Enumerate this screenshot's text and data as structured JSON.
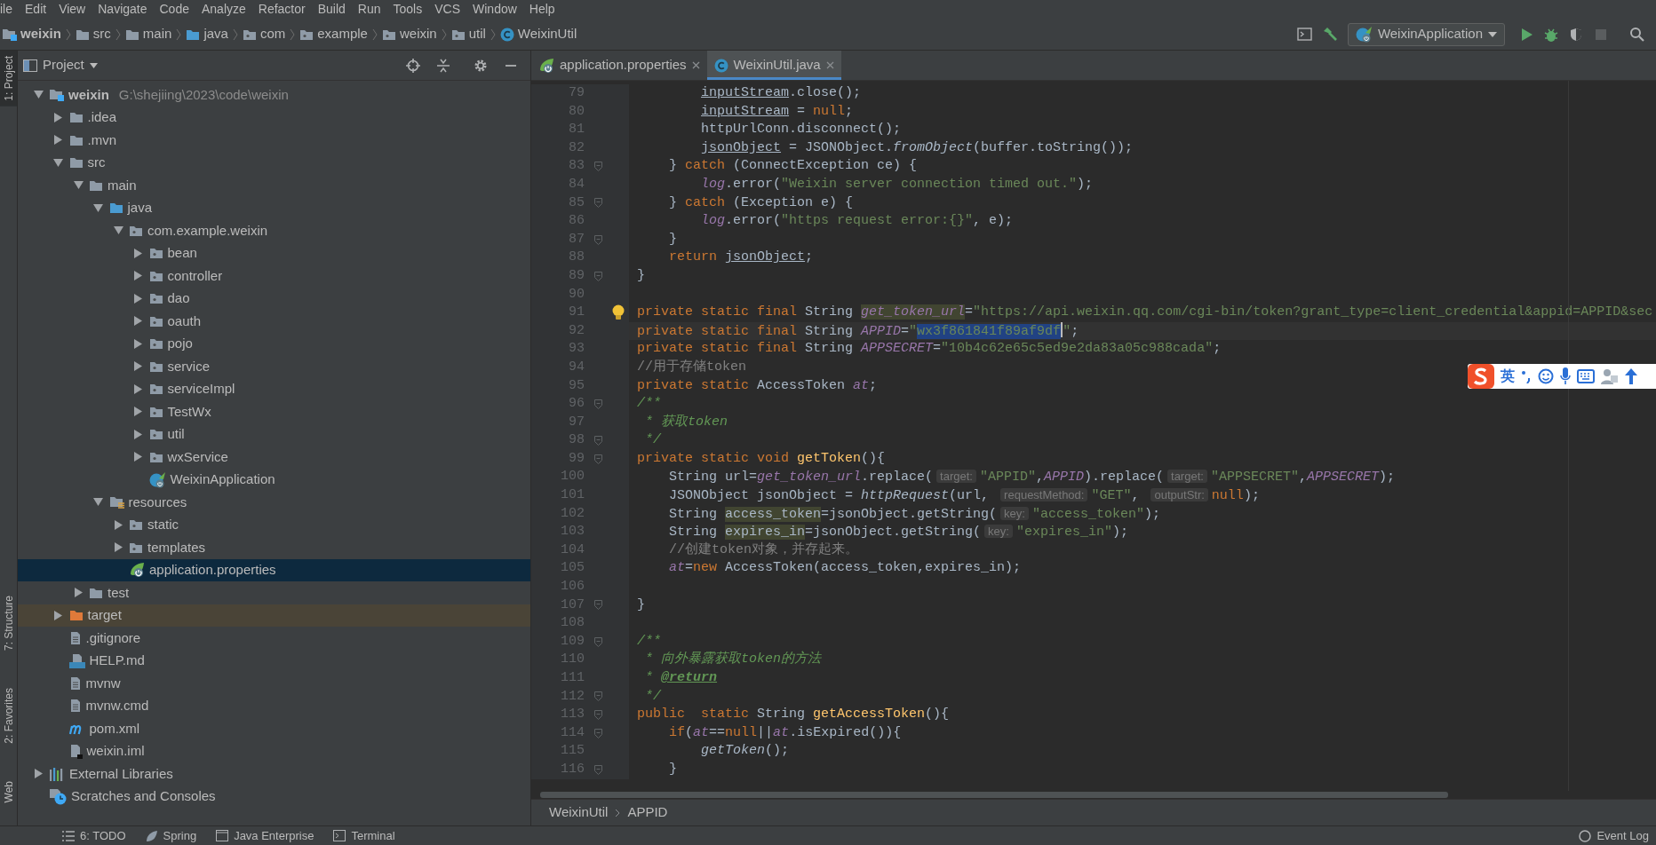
{
  "menu": [
    "ile",
    "Edit",
    "View",
    "Navigate",
    "Code",
    "Analyze",
    "Refactor",
    "Build",
    "Run",
    "Tools",
    "VCS",
    "Window",
    "Help"
  ],
  "navigation_bar": {
    "breadcrumbs": [
      {
        "label": "weixin",
        "kind": "module"
      },
      {
        "label": "src",
        "kind": "folder"
      },
      {
        "label": "main",
        "kind": "folder"
      },
      {
        "label": "java",
        "kind": "source-folder"
      },
      {
        "label": "com",
        "kind": "package"
      },
      {
        "label": "example",
        "kind": "package"
      },
      {
        "label": "weixin",
        "kind": "package"
      },
      {
        "label": "util",
        "kind": "package"
      },
      {
        "label": "WeixinUtil",
        "kind": "class"
      }
    ],
    "run_configuration": "WeixinApplication"
  },
  "tool_strip": [
    {
      "label": "1: Project",
      "selected": true
    },
    {
      "label": "7: Structure",
      "selected": false
    },
    {
      "label": "2: Favorites",
      "selected": false
    },
    {
      "label": "Web",
      "selected": false
    }
  ],
  "project_panel": {
    "title": "Project",
    "tree": [
      {
        "label": "weixin",
        "path": "G:\\shejiing\\2023\\code\\weixin",
        "kind": "module",
        "expanded": true,
        "selected": false,
        "children": [
          {
            "label": ".idea",
            "kind": "folder",
            "expanded": false,
            "selected": false
          },
          {
            "label": ".mvn",
            "kind": "folder",
            "expanded": false,
            "selected": false
          },
          {
            "label": "src",
            "kind": "folder",
            "expanded": true,
            "selected": false,
            "children": [
              {
                "label": "main",
                "kind": "folder",
                "expanded": true,
                "selected": false,
                "children": [
                  {
                    "label": "java",
                    "kind": "source-folder",
                    "expanded": true,
                    "selected": false,
                    "children": [
                      {
                        "label": "com.example.weixin",
                        "kind": "package",
                        "expanded": true,
                        "selected": false,
                        "children": [
                          {
                            "label": "bean",
                            "kind": "package",
                            "expanded": false,
                            "selected": false
                          },
                          {
                            "label": "controller",
                            "kind": "package",
                            "expanded": false,
                            "selected": false
                          },
                          {
                            "label": "dao",
                            "kind": "package",
                            "expanded": false,
                            "selected": false
                          },
                          {
                            "label": "oauth",
                            "kind": "package",
                            "expanded": false,
                            "selected": false
                          },
                          {
                            "label": "pojo",
                            "kind": "package",
                            "expanded": false,
                            "selected": false
                          },
                          {
                            "label": "service",
                            "kind": "package",
                            "expanded": false,
                            "selected": false
                          },
                          {
                            "label": "serviceImpl",
                            "kind": "package",
                            "expanded": false,
                            "selected": false
                          },
                          {
                            "label": "TestWx",
                            "kind": "package",
                            "expanded": false,
                            "selected": false
                          },
                          {
                            "label": "util",
                            "kind": "package",
                            "expanded": false,
                            "selected": false
                          },
                          {
                            "label": "wxService",
                            "kind": "package",
                            "expanded": false,
                            "selected": false
                          },
                          {
                            "label": "WeixinApplication",
                            "kind": "spring-app",
                            "selected": false
                          }
                        ]
                      }
                    ]
                  },
                  {
                    "label": "resources",
                    "kind": "resources-folder",
                    "expanded": true,
                    "selected": false,
                    "children": [
                      {
                        "label": "static",
                        "kind": "package",
                        "expanded": false,
                        "selected": false
                      },
                      {
                        "label": "templates",
                        "kind": "package",
                        "expanded": false,
                        "selected": false
                      },
                      {
                        "label": "application.properties",
                        "kind": "spring-config",
                        "selected": true
                      }
                    ]
                  }
                ]
              },
              {
                "label": "test",
                "kind": "folder",
                "expanded": false,
                "selected": false
              }
            ]
          },
          {
            "label": "target",
            "kind": "excluded-folder",
            "expanded": false,
            "selected": false
          },
          {
            "label": ".gitignore",
            "kind": "file",
            "selected": false
          },
          {
            "label": "HELP.md",
            "kind": "markdown",
            "selected": false
          },
          {
            "label": "mvnw",
            "kind": "file",
            "selected": false
          },
          {
            "label": "mvnw.cmd",
            "kind": "file",
            "selected": false
          },
          {
            "label": "pom.xml",
            "kind": "maven",
            "selected": false
          },
          {
            "label": "weixin.iml",
            "kind": "iml",
            "selected": false
          }
        ]
      },
      {
        "label": "External Libraries",
        "kind": "libraries",
        "expanded": false,
        "selected": false
      },
      {
        "label": "Scratches and Consoles",
        "kind": "scratches",
        "selected": false
      }
    ]
  },
  "editor": {
    "tabs": [
      {
        "label": "application.properties",
        "kind": "spring-config",
        "selected": false
      },
      {
        "label": "WeixinUtil.java",
        "kind": "class",
        "selected": true
      }
    ],
    "lines": [
      {
        "number": "79",
        "tokens": [
          {
            "kind": "reassigned",
            "text": "        inputStream"
          },
          {
            "kind": "plain",
            "text": ".close();"
          }
        ]
      },
      {
        "number": "80",
        "tokens": [
          {
            "kind": "reassigned",
            "text": "        inputStream"
          },
          {
            "kind": "plain",
            "text": " = "
          },
          {
            "kind": "keyword",
            "text": "null"
          },
          {
            "kind": "plain",
            "text": ";"
          }
        ]
      },
      {
        "number": "81",
        "tokens": [
          {
            "kind": "plain",
            "text": "        httpUrlConn.disconnect();"
          }
        ]
      },
      {
        "number": "82",
        "tokens": [
          {
            "kind": "reassigned",
            "text": "        jsonObject"
          },
          {
            "kind": "plain",
            "text": " = JSONObject."
          },
          {
            "kind": "static-call",
            "text": "fromObject"
          },
          {
            "kind": "plain",
            "text": "(buffer.toString());"
          }
        ]
      },
      {
        "number": "83",
        "fold": true,
        "tokens": [
          {
            "kind": "plain",
            "text": "    } "
          },
          {
            "kind": "keyword",
            "text": "catch"
          },
          {
            "kind": "plain",
            "text": " (ConnectException ce) {"
          }
        ]
      },
      {
        "number": "84",
        "tokens": [
          {
            "kind": "field",
            "text": "        log"
          },
          {
            "kind": "plain",
            "text": ".error("
          },
          {
            "kind": "string",
            "text": "\"Weixin server connection timed out.\""
          },
          {
            "kind": "plain",
            "text": ");"
          }
        ]
      },
      {
        "number": "85",
        "fold": true,
        "tokens": [
          {
            "kind": "plain",
            "text": "    } "
          },
          {
            "kind": "keyword",
            "text": "catch"
          },
          {
            "kind": "plain",
            "text": " (Exception e) {"
          }
        ]
      },
      {
        "number": "86",
        "tokens": [
          {
            "kind": "field",
            "text": "        log"
          },
          {
            "kind": "plain",
            "text": ".error("
          },
          {
            "kind": "string",
            "text": "\"https request error:{}\""
          },
          {
            "kind": "plain",
            "text": ", e);"
          }
        ]
      },
      {
        "number": "87",
        "fold": true,
        "tokens": [
          {
            "kind": "plain",
            "text": "    }"
          }
        ]
      },
      {
        "number": "88",
        "tokens": [
          {
            "kind": "keyword",
            "text": "    return "
          },
          {
            "kind": "reassigned",
            "text": "jsonObject"
          },
          {
            "kind": "plain",
            "text": ";"
          }
        ]
      },
      {
        "number": "89",
        "fold": true,
        "tokens": [
          {
            "kind": "plain",
            "text": "}"
          }
        ]
      },
      {
        "number": "90"
      },
      {
        "number": "91",
        "bulb": true,
        "tokens": [
          {
            "kind": "keyword",
            "text": "private static final "
          },
          {
            "kind": "plain",
            "text": "String "
          },
          {
            "kind": "field-usage",
            "text": "get_token_url"
          },
          {
            "kind": "plain",
            "text": "="
          },
          {
            "kind": "string",
            "text": "\"https://api.weixin.qq.com/cgi-bin/token?grant_type=client_credential&appid=APPID&sec"
          }
        ]
      },
      {
        "number": "92",
        "current": true,
        "tokens": [
          {
            "kind": "keyword",
            "text": "private static final "
          },
          {
            "kind": "plain",
            "text": "String "
          },
          {
            "kind": "field",
            "text": "APPID"
          },
          {
            "kind": "plain",
            "text": "="
          },
          {
            "kind": "string",
            "text": "\""
          },
          {
            "kind": "selection",
            "text": "wx3f861841f89af9df"
          },
          {
            "kind": "string",
            "text": "\""
          },
          {
            "kind": "plain",
            "text": ";"
          }
        ]
      },
      {
        "number": "93",
        "tokens": [
          {
            "kind": "keyword",
            "text": "private static final "
          },
          {
            "kind": "plain",
            "text": "String "
          },
          {
            "kind": "field",
            "text": "APPSECRET"
          },
          {
            "kind": "plain",
            "text": "="
          },
          {
            "kind": "string",
            "text": "\"10b4c62e65c5ed9e2da83a05c988cada\""
          },
          {
            "kind": "plain",
            "text": ";"
          }
        ]
      },
      {
        "number": "94",
        "tokens": [
          {
            "kind": "comment",
            "text": "//用于存储token"
          }
        ]
      },
      {
        "number": "95",
        "tokens": [
          {
            "kind": "keyword",
            "text": "private static "
          },
          {
            "kind": "plain",
            "text": "AccessToken "
          },
          {
            "kind": "field",
            "text": "at"
          },
          {
            "kind": "plain",
            "text": ";"
          }
        ]
      },
      {
        "number": "96",
        "fold": true,
        "tokens": [
          {
            "kind": "doc",
            "text": "/**"
          }
        ]
      },
      {
        "number": "97",
        "tokens": [
          {
            "kind": "doc",
            "text": " * 获取token"
          }
        ]
      },
      {
        "number": "98",
        "fold": true,
        "tokens": [
          {
            "kind": "doc",
            "text": " */"
          }
        ]
      },
      {
        "number": "99",
        "fold": true,
        "tokens": [
          {
            "kind": "keyword",
            "text": "private static void "
          },
          {
            "kind": "method",
            "text": "getToken"
          },
          {
            "kind": "plain",
            "text": "(){"
          }
        ]
      },
      {
        "number": "100",
        "tokens": [
          {
            "kind": "plain",
            "text": "    String url="
          },
          {
            "kind": "field",
            "text": "get_token_url"
          },
          {
            "kind": "plain",
            "text": ".replace("
          },
          {
            "kind": "hint",
            "text": "target:"
          },
          {
            "kind": "string",
            "text": "\"APPID\""
          },
          {
            "kind": "plain",
            "text": ","
          },
          {
            "kind": "field",
            "text": "APPID"
          },
          {
            "kind": "plain",
            "text": ").replace("
          },
          {
            "kind": "hint",
            "text": "target:"
          },
          {
            "kind": "string",
            "text": "\"APPSECRET\""
          },
          {
            "kind": "plain",
            "text": ","
          },
          {
            "kind": "field",
            "text": "APPSECRET"
          },
          {
            "kind": "plain",
            "text": ");"
          }
        ]
      },
      {
        "number": "101",
        "tokens": [
          {
            "kind": "plain",
            "text": "    JSONObject jsonObject = "
          },
          {
            "kind": "static-call",
            "text": "httpRequest"
          },
          {
            "kind": "plain",
            "text": "(url, "
          },
          {
            "kind": "hint",
            "text": "requestMethod:"
          },
          {
            "kind": "string",
            "text": "\"GET\""
          },
          {
            "kind": "plain",
            "text": ", "
          },
          {
            "kind": "hint",
            "text": "outputStr:"
          },
          {
            "kind": "keyword",
            "text": "null"
          },
          {
            "kind": "plain",
            "text": ");"
          }
        ]
      },
      {
        "number": "102",
        "tokens": [
          {
            "kind": "plain",
            "text": "    String "
          },
          {
            "kind": "usage",
            "text": "access_token"
          },
          {
            "kind": "plain",
            "text": "=jsonObject.getString("
          },
          {
            "kind": "hint",
            "text": "key:"
          },
          {
            "kind": "string",
            "text": "\"access_token\""
          },
          {
            "kind": "plain",
            "text": ");"
          }
        ]
      },
      {
        "number": "103",
        "tokens": [
          {
            "kind": "plain",
            "text": "    String "
          },
          {
            "kind": "usage",
            "text": "expires_in"
          },
          {
            "kind": "plain",
            "text": "=jsonObject.getString("
          },
          {
            "kind": "hint",
            "text": "key:"
          },
          {
            "kind": "string",
            "text": "\"expires_in\""
          },
          {
            "kind": "plain",
            "text": ");"
          }
        ]
      },
      {
        "number": "104",
        "tokens": [
          {
            "kind": "comment",
            "text": "    //创建token对象，并存起来。"
          }
        ]
      },
      {
        "number": "105",
        "tokens": [
          {
            "kind": "field",
            "text": "    at"
          },
          {
            "kind": "plain",
            "text": "="
          },
          {
            "kind": "keyword",
            "text": "new"
          },
          {
            "kind": "plain",
            "text": " AccessToken(access_token,expires_in);"
          }
        ]
      },
      {
        "number": "106"
      },
      {
        "number": "107",
        "fold": true,
        "tokens": [
          {
            "kind": "plain",
            "text": "}"
          }
        ]
      },
      {
        "number": "108"
      },
      {
        "number": "109",
        "fold": true,
        "tokens": [
          {
            "kind": "doc",
            "text": "/**"
          }
        ]
      },
      {
        "number": "110",
        "tokens": [
          {
            "kind": "doc",
            "text": " * 向外暴露获取token的方法"
          }
        ]
      },
      {
        "number": "111",
        "tokens": [
          {
            "kind": "doc",
            "text": " * "
          },
          {
            "kind": "doc-tag",
            "text": "@return"
          }
        ]
      },
      {
        "number": "112",
        "fold": true,
        "tokens": [
          {
            "kind": "doc",
            "text": " */"
          }
        ]
      },
      {
        "number": "113",
        "fold": true,
        "tokens": [
          {
            "kind": "keyword",
            "text": "public  static "
          },
          {
            "kind": "plain",
            "text": "String "
          },
          {
            "kind": "method",
            "text": "getAccessToken"
          },
          {
            "kind": "plain",
            "text": "(){"
          }
        ]
      },
      {
        "number": "114",
        "fold": true,
        "tokens": [
          {
            "kind": "keyword",
            "text": "    if"
          },
          {
            "kind": "plain",
            "text": "("
          },
          {
            "kind": "field",
            "text": "at"
          },
          {
            "kind": "plain",
            "text": "=="
          },
          {
            "kind": "keyword",
            "text": "null"
          },
          {
            "kind": "plain",
            "text": "||"
          },
          {
            "kind": "field",
            "text": "at"
          },
          {
            "kind": "plain",
            "text": ".isExpired()){"
          }
        ]
      },
      {
        "number": "115",
        "tokens": [
          {
            "kind": "static-call",
            "text": "        getToken"
          },
          {
            "kind": "plain",
            "text": "();"
          }
        ]
      },
      {
        "number": "116",
        "fold": true,
        "tokens": [
          {
            "kind": "plain",
            "text": "    }"
          }
        ]
      }
    ],
    "breadcrumbs": [
      "WeixinUtil",
      "APPID"
    ]
  },
  "input_method_bar": {
    "label": "英"
  },
  "bottom_tools": [
    {
      "label": "6: TODO",
      "kind": "list"
    },
    {
      "label": "Spring",
      "kind": "leaf"
    },
    {
      "label": "Java Enterprise",
      "kind": "window"
    },
    {
      "label": "Terminal",
      "kind": "terminal"
    }
  ],
  "event_log": "Event Log"
}
